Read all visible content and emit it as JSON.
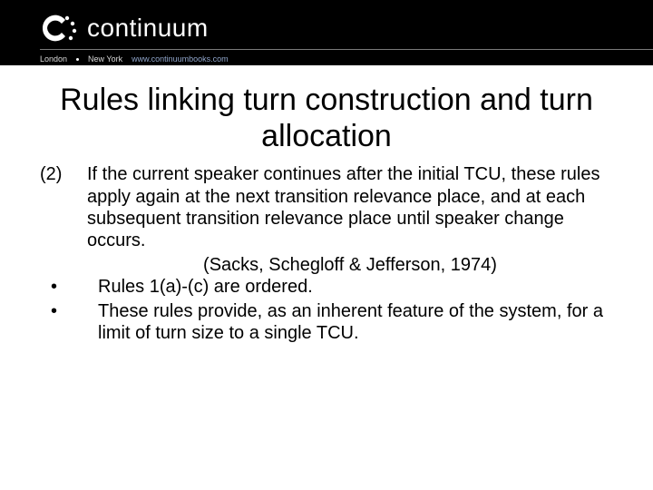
{
  "header": {
    "brand": "continuum",
    "footer_left": "London",
    "footer_mid": "New York",
    "footer_url": "www.continuumbooks.com"
  },
  "slide": {
    "title": "Rules linking turn construction and turn allocation",
    "item_marker": "(2)",
    "item_text": "If the current speaker continues after the initial TCU, these rules apply again at the next transition relevance place, and at each subsequent transition relevance place until speaker change occurs.",
    "citation": "(Sacks, Schegloff & Jefferson, 1974)",
    "bullets": [
      "Rules 1(a)-(c) are ordered.",
      "These rules provide, as an inherent feature of the system, for a limit of turn size to a single TCU."
    ]
  }
}
